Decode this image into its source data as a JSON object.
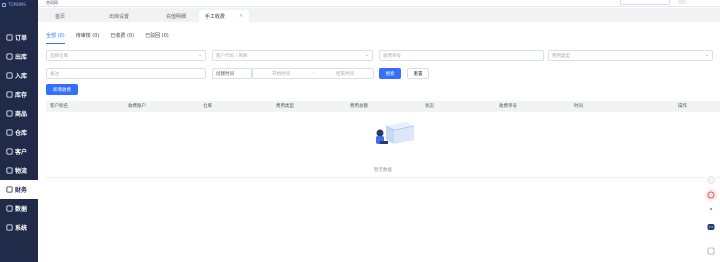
{
  "app": {
    "logo_text": "TOPWMS"
  },
  "sidebar": {
    "items": [
      {
        "label": "订单",
        "icon": "orders-icon"
      },
      {
        "label": "出库",
        "icon": "outbound-icon"
      },
      {
        "label": "入库",
        "icon": "inbound-icon"
      },
      {
        "label": "库存",
        "icon": "stock-icon"
      },
      {
        "label": "商品",
        "icon": "goods-icon"
      },
      {
        "label": "仓库",
        "icon": "warehouse-icon"
      },
      {
        "label": "客户",
        "icon": "customer-icon"
      },
      {
        "label": "物流",
        "icon": "logistics-icon"
      },
      {
        "label": "财务",
        "icon": "finance-icon"
      },
      {
        "label": "数据",
        "icon": "data-icon"
      },
      {
        "label": "系统",
        "icon": "system-icon"
      }
    ],
    "active_index": 8
  },
  "topbar": {
    "title": "合同网"
  },
  "tabs": [
    {
      "label": "首页"
    },
    {
      "label": "出库设置"
    },
    {
      "label": "充值明细"
    },
    {
      "label": "手工收费",
      "close": "×"
    }
  ],
  "subtabs": [
    {
      "label": "全部 (0)"
    },
    {
      "label": "待审核 (0)"
    },
    {
      "label": "已收费 (0)"
    },
    {
      "label": "已驳回 (0)"
    }
  ],
  "filters": {
    "warehouse_placeholder": "选择仓库",
    "customer_placeholder": "客户代码 / 简称",
    "fee_no_placeholder": "收费单号",
    "fee_type_placeholder": "费用类型",
    "remark_placeholder": "备注",
    "time_type": "创建时间",
    "start_placeholder": "开始时间",
    "range_sep": "-",
    "end_placeholder": "结束时间",
    "search_label": "搜索",
    "reset_label": "重置",
    "add_label": "新增收费"
  },
  "table": {
    "columns": [
      "客户别名",
      "收费账户",
      "仓库",
      "费用类型",
      "费用总额",
      "状态",
      "收费单号",
      "时间",
      "操作"
    ],
    "empty_text": "暂无数据"
  },
  "colors": {
    "sidebar": "#1f2b48",
    "accent": "#3370ff"
  }
}
